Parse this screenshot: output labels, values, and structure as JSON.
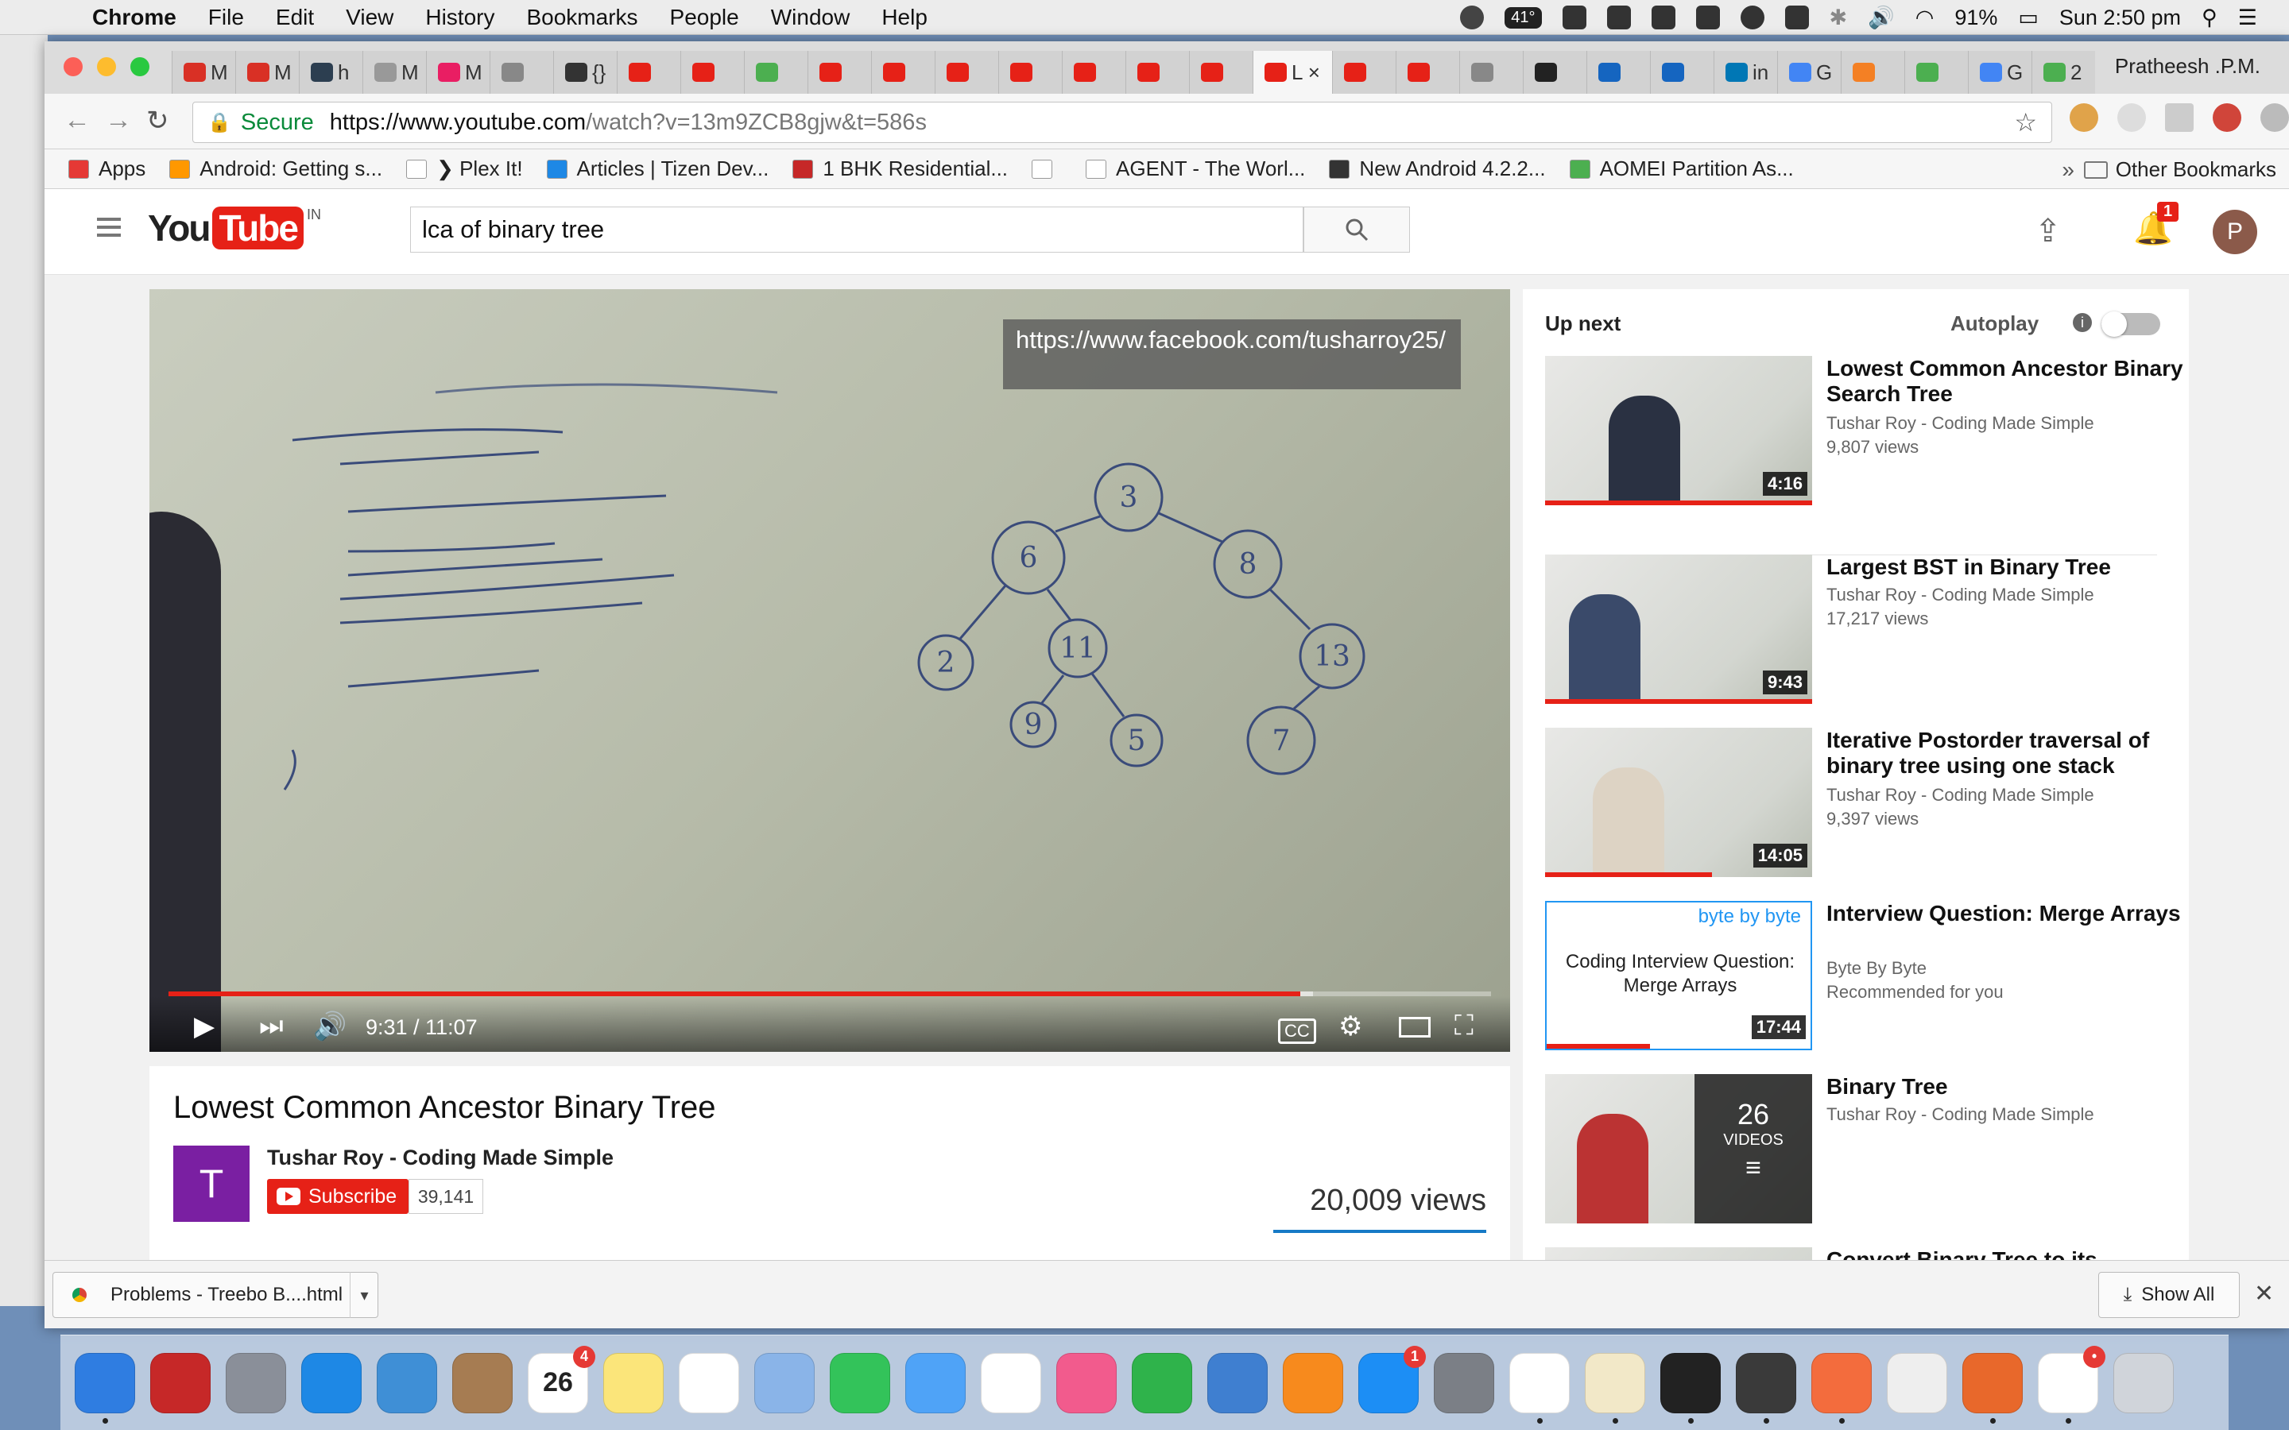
{
  "menubar": {
    "app": "Chrome",
    "items": [
      "File",
      "Edit",
      "View",
      "History",
      "Bookmarks",
      "People",
      "Window",
      "Help"
    ],
    "temperature": "41°",
    "battery": "91%",
    "clock": "Sun 2:50 pm"
  },
  "browser": {
    "profile_name": "Pratheesh .P.M.",
    "tabs": [
      {
        "label": "M",
        "color": "#d93025"
      },
      {
        "label": "M",
        "color": "#d93025"
      },
      {
        "label": "h",
        "color": "#2c3e50"
      },
      {
        "label": "M",
        "color": "#999999"
      },
      {
        "label": "M",
        "color": "#e91e63"
      },
      {
        "label": "",
        "color": "#888888"
      },
      {
        "label": "{}",
        "color": "#333333"
      },
      {
        "label": "",
        "color": "#e62117"
      },
      {
        "label": "",
        "color": "#e62117"
      },
      {
        "label": "",
        "color": "#4caf50"
      },
      {
        "label": "",
        "color": "#e62117"
      },
      {
        "label": "",
        "color": "#e62117"
      },
      {
        "label": "",
        "color": "#e62117"
      },
      {
        "label": "",
        "color": "#e62117"
      },
      {
        "label": "",
        "color": "#e62117"
      },
      {
        "label": "",
        "color": "#e62117"
      },
      {
        "label": "",
        "color": "#e62117"
      },
      {
        "label": "L ×",
        "color": "#e62117",
        "active": true
      },
      {
        "label": "",
        "color": "#e62117"
      },
      {
        "label": "",
        "color": "#e62117"
      },
      {
        "label": "",
        "color": "#888888"
      },
      {
        "label": "",
        "color": "#222222"
      },
      {
        "label": "",
        "color": "#1565c0"
      },
      {
        "label": "",
        "color": "#1565c0"
      },
      {
        "label": "in",
        "color": "#0077b5"
      },
      {
        "label": "G",
        "color": "#4285f4"
      },
      {
        "label": "",
        "color": "#f48024"
      },
      {
        "label": "",
        "color": "#4caf50"
      },
      {
        "label": "G",
        "color": "#4285f4"
      },
      {
        "label": "2",
        "color": "#4caf50"
      }
    ],
    "secure_label": "Secure",
    "url_host": "https://www.youtube.com",
    "url_path": "/watch?v=13m9ZCB8gjw&t=586s",
    "bookmarks": [
      {
        "label": "Apps",
        "color": "#e53935"
      },
      {
        "label": "Android: Getting s...",
        "color": "#ff9800"
      },
      {
        "label": "❯ Plex It!",
        "color": "#ffffff"
      },
      {
        "label": "Articles | Tizen Dev...",
        "color": "#1e88e5"
      },
      {
        "label": "1 BHK Residential...",
        "color": "#c62828"
      },
      {
        "label": "",
        "color": "#ffffff"
      },
      {
        "label": "AGENT - The Worl...",
        "color": "#ffffff"
      },
      {
        "label": "New Android 4.2.2...",
        "color": "#333333"
      },
      {
        "label": "AOMEI Partition As...",
        "color": "#4caf50"
      }
    ],
    "bookmarks_more": "»",
    "other_bookmarks": "Other Bookmarks"
  },
  "youtube": {
    "logo_you": "You",
    "logo_tube": "Tube",
    "logo_region": "IN",
    "search_query": "lca of binary tree",
    "notifications": "1",
    "avatar_letter": "P",
    "player": {
      "overlay_text": "https://www.facebook.com/tusharroy25/",
      "current_time": "9:31",
      "duration": "11:07",
      "time_display": "9:31 / 11:07",
      "progress": 0.856
    },
    "video": {
      "title": "Lowest Common Ancestor Binary Tree",
      "channel": "Tushar Roy - Coding Made Simple",
      "channel_initial": "T",
      "subscribe_label": "Subscribe",
      "subscriber_count": "39,141",
      "views": "20,009 views"
    },
    "sidebar": {
      "up_next": "Up next",
      "autoplay": "Autoplay",
      "items": [
        {
          "title": "Lowest Common Ancestor Binary Search Tree",
          "channel": "Tushar Roy - Coding Made Simple",
          "meta": "9,807 views",
          "duration": "4:16"
        },
        {
          "title": "Largest BST in Binary Tree",
          "channel": "Tushar Roy - Coding Made Simple",
          "meta": "17,217 views",
          "duration": "9:43"
        },
        {
          "title": "Iterative Postorder traversal of binary tree using one stack",
          "channel": "Tushar Roy - Coding Made Simple",
          "meta": "9,397 views",
          "duration": "14:05"
        },
        {
          "title": "Interview Question: Merge Arrays",
          "channel": "Byte By Byte",
          "meta": "Recommended for you",
          "duration": "17:44",
          "thumb_brand": "byte by byte",
          "thumb_text": "Coding Interview Question: Merge Arrays"
        },
        {
          "title": "Binary Tree",
          "channel": "Tushar Roy - Coding Made Simple",
          "meta": "",
          "playlist_count": "26",
          "playlist_label": "VIDEOS"
        },
        {
          "title": "Convert Binary Tree to its",
          "channel": "",
          "meta": ""
        }
      ]
    }
  },
  "downloads": {
    "file": "Problems - Treebo B....html",
    "show_all": "Show All"
  },
  "dock": [
    {
      "name": "finder",
      "color": "#2f7de1"
    },
    {
      "name": "security",
      "color": "#c62828"
    },
    {
      "name": "launchpad",
      "color": "#8a8f99"
    },
    {
      "name": "safari",
      "color": "#1e88e5"
    },
    {
      "name": "mail",
      "color": "#3f8fd6"
    },
    {
      "name": "contacts",
      "color": "#a67c52"
    },
    {
      "name": "calendar",
      "color": "#ffffff",
      "text": "26",
      "badge": "4"
    },
    {
      "name": "notes",
      "color": "#fbe57a"
    },
    {
      "name": "reminders",
      "color": "#ffffff"
    },
    {
      "name": "preview",
      "color": "#8ab4e8"
    },
    {
      "name": "facetime",
      "color": "#33c35a"
    },
    {
      "name": "messages",
      "color": "#4fa3f7"
    },
    {
      "name": "photos",
      "color": "#ffffff"
    },
    {
      "name": "itunes",
      "color": "#f25b8d"
    },
    {
      "name": "numbers",
      "color": "#2fb34b"
    },
    {
      "name": "keynote",
      "color": "#3f7fd0"
    },
    {
      "name": "ibooks",
      "color": "#f78a1d"
    },
    {
      "name": "app-store",
      "color": "#1c8ef5",
      "badge": "1"
    },
    {
      "name": "system-preferences",
      "color": "#7b7f86"
    },
    {
      "name": "chrome",
      "color": "#ffffff"
    },
    {
      "name": "textedit",
      "color": "#f2e8c8"
    },
    {
      "name": "terminal",
      "color": "#222222"
    },
    {
      "name": "evernote",
      "color": "#3a3a3a"
    },
    {
      "name": "postman",
      "color": "#f36c3d"
    },
    {
      "name": "script-editor",
      "color": "#eeeeee"
    },
    {
      "name": "firefox",
      "color": "#e8682b"
    },
    {
      "name": "slack",
      "color": "#ffffff",
      "badge": "•"
    },
    {
      "name": "trash",
      "color": "#d0d4da"
    }
  ]
}
